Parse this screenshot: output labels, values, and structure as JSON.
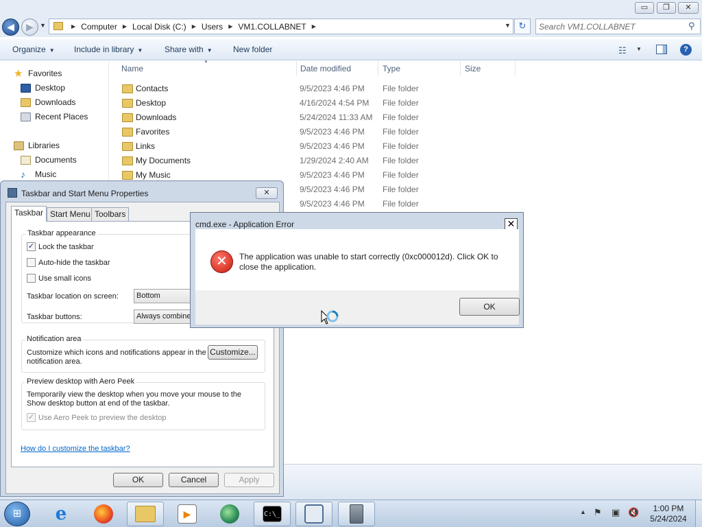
{
  "explorer": {
    "window_controls": {
      "minimize": "▭",
      "maximize": "❐",
      "close": "✕"
    },
    "address_parts": [
      "Computer",
      "Local Disk (C:)",
      "Users",
      "VM1.COLLABNET"
    ],
    "search_placeholder": "Search VM1.COLLABNET",
    "toolbar": {
      "organize": "Organize",
      "include_in_library": "Include in library",
      "share_with": "Share with",
      "new_folder": "New folder"
    },
    "nav": {
      "favorites": "Favorites",
      "desktop": "Desktop",
      "downloads": "Downloads",
      "recent_places": "Recent Places",
      "libraries": "Libraries",
      "documents": "Documents",
      "music": "Music"
    },
    "columns": {
      "name": "Name",
      "date_modified": "Date modified",
      "type": "Type",
      "size": "Size"
    },
    "files": [
      {
        "name": "Contacts",
        "date": "9/5/2023 4:46 PM",
        "type": "File folder"
      },
      {
        "name": "Desktop",
        "date": "4/16/2024 4:54 PM",
        "type": "File folder"
      },
      {
        "name": "Downloads",
        "date": "5/24/2024 11:33 AM",
        "type": "File folder"
      },
      {
        "name": "Favorites",
        "date": "9/5/2023 4:46 PM",
        "type": "File folder"
      },
      {
        "name": "Links",
        "date": "9/5/2023 4:46 PM",
        "type": "File folder"
      },
      {
        "name": "My Documents",
        "date": "1/29/2024 2:40 AM",
        "type": "File folder"
      },
      {
        "name": "My Music",
        "date": "9/5/2023 4:46 PM",
        "type": "File folder"
      },
      {
        "name": "",
        "date": "9/5/2023 4:46 PM",
        "type": "File folder"
      },
      {
        "name": "",
        "date": "9/5/2023 4:46 PM",
        "type": "File folder"
      }
    ]
  },
  "props_dialog": {
    "title": "Taskbar and Start Menu Properties",
    "close": "✕",
    "tabs": [
      "Taskbar",
      "Start Menu",
      "Toolbars"
    ],
    "appearance": {
      "heading": "Taskbar appearance",
      "lock": {
        "label": "Lock the taskbar",
        "checked": true
      },
      "autohide": {
        "label": "Auto-hide the taskbar",
        "checked": false
      },
      "small_icons": {
        "label": "Use small icons",
        "checked": false
      },
      "location_label": "Taskbar location on screen:",
      "location_value": "Bottom",
      "buttons_label": "Taskbar buttons:",
      "buttons_value": "Always combine"
    },
    "notification": {
      "heading": "Notification area",
      "text": "Customize which icons and notifications appear in the notification area.",
      "customize_button": "Customize..."
    },
    "aero_peek": {
      "heading": "Preview desktop with Aero Peek",
      "text": "Temporarily view the desktop when you move your mouse to the Show desktop button at end of the taskbar.",
      "checkbox": {
        "label": "Use Aero Peek to preview the desktop",
        "checked": true
      }
    },
    "help_link": "How do I customize the taskbar?",
    "ok": "OK",
    "cancel": "Cancel",
    "apply": "Apply"
  },
  "error_dialog": {
    "title": "cmd.exe - Application Error",
    "close": "✕",
    "icon_glyph": "✕",
    "message": "The application was unable to start correctly (0xc000012d). Click OK to close the application.",
    "ok": "OK"
  },
  "taskbar": {
    "start_glyph": "⊞",
    "ie_glyph": "e",
    "media_glyph": "▶",
    "cmd_glyph": "C:\\_",
    "time": "1:00 PM",
    "date": "5/24/2024"
  }
}
